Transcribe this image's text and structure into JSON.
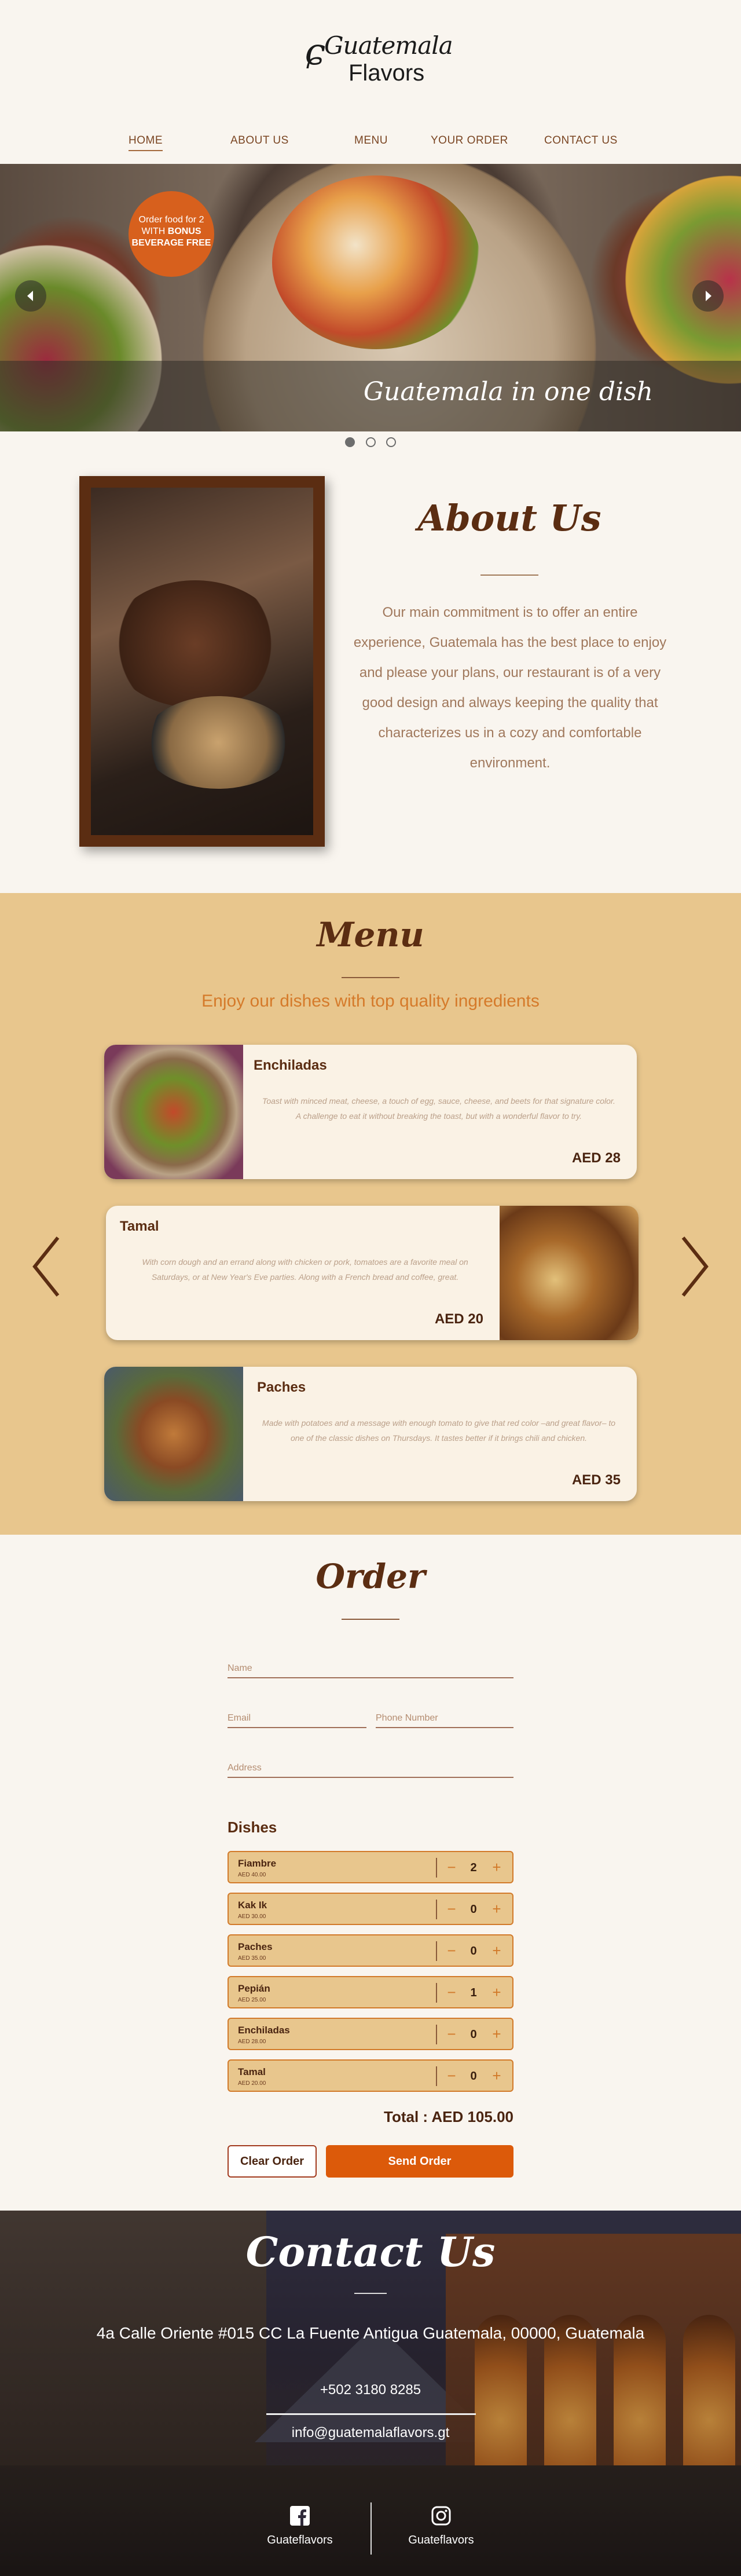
{
  "brand": {
    "logo_script": "Guatemala",
    "logo_word": "Flavors"
  },
  "nav": {
    "items": [
      {
        "label": "HOME"
      },
      {
        "label": "ABOUT US"
      },
      {
        "label": "MENU"
      },
      {
        "label": "YOUR ORDER"
      },
      {
        "label": "CONTACT US"
      }
    ]
  },
  "hero": {
    "promo_line1": "Order food for 2",
    "promo_line2": "WITH",
    "promo_bold1": "BONUS",
    "promo_bold2": "BEVERAGE FREE",
    "caption": "Guatemala in one dish",
    "prev_icon": "chevron-left",
    "next_icon": "chevron-right",
    "slides_total": 3,
    "active_slide": 1
  },
  "about": {
    "title": "About Us",
    "text": "Our main commitment is to offer an entire experience, Guatemala has the best place to enjoy and please your plans, our restaurant is of a very good design and always keeping the quality that characterizes us in a cozy and comfortable environment."
  },
  "menu": {
    "title": "Menu",
    "subtitle": "Enjoy our dishes with top quality ingredients",
    "dishes": [
      {
        "name": "Enchiladas",
        "description": "Toast with minced meat, cheese, a touch of egg, sauce, cheese, and beets for that signature color. A challenge to eat it without breaking the toast, but with a wonderful flavor to try.",
        "price": "AED 28"
      },
      {
        "name": "Tamal",
        "description": "With corn dough and an errand along with chicken or pork, tomatoes are a favorite meal on Saturdays, or at New Year's Eve parties. Along with a French bread and coffee, great.",
        "price": "AED 20"
      },
      {
        "name": "Paches",
        "description": "Made with potatoes and a message with enough tomato to give that red color –and great flavor– to one of the classic dishes on Thursdays. It tastes better if it brings chili and chicken.",
        "price": "AED 35"
      }
    ]
  },
  "order": {
    "title": "Order",
    "name_placeholder": "Name",
    "email_placeholder": "Email",
    "phone_placeholder": "Phone Number",
    "address_placeholder": "Address",
    "dishes_label": "Dishes",
    "items": [
      {
        "name": "Fiambre",
        "price": "AED 40.00",
        "qty": "2"
      },
      {
        "name": "Kak Ik",
        "price": "AED 30.00",
        "qty": "0"
      },
      {
        "name": "Paches",
        "price": "AED 35.00",
        "qty": "0"
      },
      {
        "name": "Pepián",
        "price": "AED 25.00",
        "qty": "1"
      },
      {
        "name": "Enchiladas",
        "price": "AED 28.00",
        "qty": "0"
      },
      {
        "name": "Tamal",
        "price": "AED 20.00",
        "qty": "0"
      }
    ],
    "minus": "−",
    "plus": "+",
    "total_label": "Total :",
    "total_value": "AED 105.00",
    "clear_label": "Clear Order",
    "send_label": "Send Order"
  },
  "contact": {
    "title": "Contact Us",
    "address": "4a Calle Oriente #015 CC La Fuente Antigua Guatemala, 00000, Guatemala",
    "phone": "+502 3180 8285",
    "email": "info@guatemalaflavors.gt",
    "facebook_label": "Guateflavors",
    "instagram_label": "Guateflavors"
  },
  "colors": {
    "accent": "#dc5a0a",
    "brown": "#5b2d12",
    "menu_bg": "#e8c68d",
    "page_bg": "#f9f5ef"
  }
}
